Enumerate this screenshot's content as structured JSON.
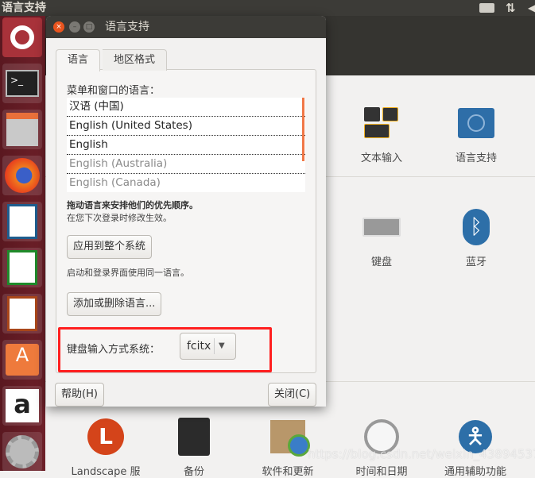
{
  "topbar": {
    "title": "语言支持",
    "icons": [
      "keyboard-indicator-icon",
      "network-arrows-icon",
      "volume-icon"
    ]
  },
  "launcher": {
    "items": [
      "ubuntu-dash-icon",
      "terminal-icon",
      "file-cabinet-icon",
      "firefox-icon",
      "libreoffice-writer-icon",
      "libreoffice-calc-icon",
      "libreoffice-impress-icon",
      "software-center-icon",
      "amazon-icon",
      "system-settings-icon"
    ]
  },
  "dialog": {
    "title": "语言支持",
    "tabs": [
      {
        "label": "语言",
        "active": true
      },
      {
        "label": "地区格式",
        "active": false
      }
    ],
    "list_label": "菜单和窗口的语言：",
    "languages": [
      {
        "label": "汉语 (中国)",
        "enabled": true
      },
      {
        "label": "English (United States)",
        "enabled": true
      },
      {
        "label": "English",
        "enabled": true
      },
      {
        "label": "English (Australia)",
        "enabled": false
      },
      {
        "label": "English (Canada)",
        "enabled": false
      }
    ],
    "drag_hint": "拖动语言来安排他们的优先顺序。",
    "effect_hint": "在您下次登录时修改生效。",
    "apply_button": "应用到整个系统",
    "apply_hint": "启动和登录界面使用同一语言。",
    "add_remove_button": "添加或删除语言...",
    "im_label": "键盘输入方式系统：",
    "im_value": "fcitx",
    "help_button": "帮助(H)",
    "close_button": "关闭(C)",
    "accent": "#f07746",
    "highlight_color": "#ff1f1f"
  },
  "settings": {
    "row1": [
      {
        "label": "文本输入",
        "icon": "text-entry-icon"
      },
      {
        "label": "语言支持",
        "icon": "language-support-icon"
      }
    ],
    "row2": [
      {
        "label": "键盘",
        "icon": "keyboard-icon"
      },
      {
        "label": "蓝牙",
        "icon": "bluetooth-icon"
      }
    ],
    "row3": [
      {
        "label": "Landscape 服",
        "icon": "landscape-icon"
      },
      {
        "label": "备份",
        "icon": "backup-safe-icon"
      },
      {
        "label": "软件和更新",
        "icon": "software-updates-icon"
      },
      {
        "label": "时间和日期",
        "icon": "clock-icon"
      },
      {
        "label": "通用辅助功能",
        "icon": "accessibility-icon"
      }
    ]
  },
  "watermark": "https://blog.csdn.net/weixin_43894537"
}
